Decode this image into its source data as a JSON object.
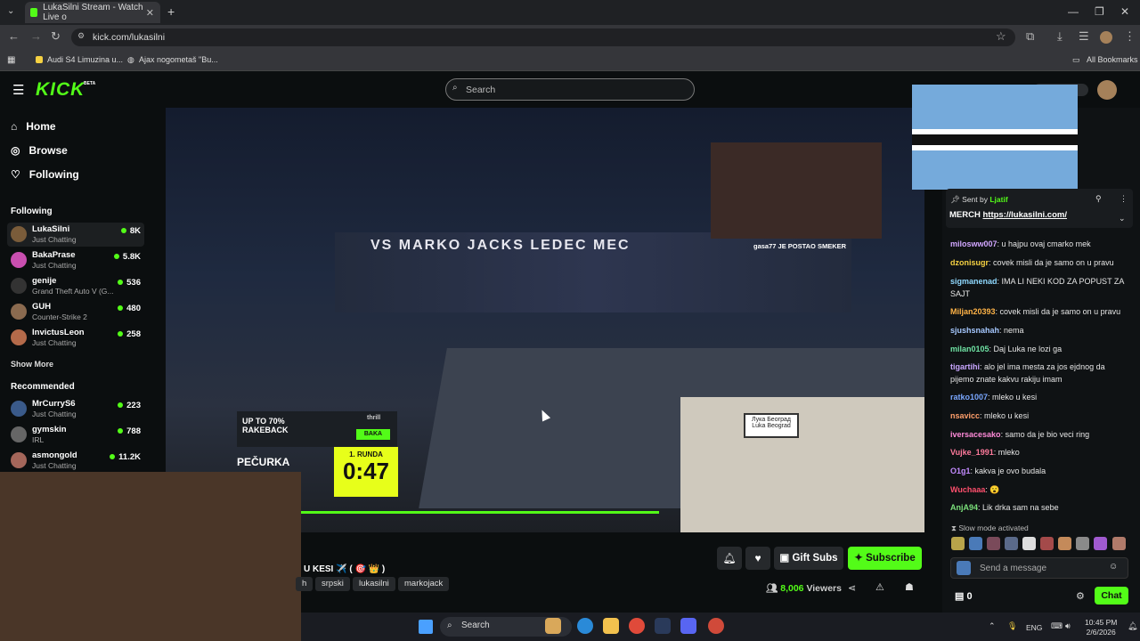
{
  "browser": {
    "tab_title": "LukaSilni Stream - Watch Live o",
    "url": "kick.com/lukasilni",
    "bookmarks": [
      "Audi S4 Limuzina u...",
      "Ajax nogometaš \"Bu..."
    ],
    "all_bookmarks": "All Bookmarks"
  },
  "header": {
    "logo": "KICK",
    "logo_badge": "BETA",
    "search_placeholder": "Search"
  },
  "sidebar": {
    "nav": [
      {
        "label": "Home",
        "icon": "home-icon"
      },
      {
        "label": "Browse",
        "icon": "compass-icon"
      },
      {
        "label": "Following",
        "icon": "heart-icon"
      }
    ],
    "following_heading": "Following",
    "following": [
      {
        "name": "LukaSilni",
        "category": "Just Chatting",
        "viewers": "8K"
      },
      {
        "name": "BakaPrase",
        "category": "Just Chatting",
        "viewers": "5.8K"
      },
      {
        "name": "genije",
        "category": "Grand Theft Auto V (G...",
        "viewers": "536"
      },
      {
        "name": "GUH",
        "category": "Counter-Strike 2",
        "viewers": "480"
      },
      {
        "name": "InvictusLeon",
        "category": "Just Chatting",
        "viewers": "258"
      }
    ],
    "show_more": "Show More",
    "recommended_heading": "Recommended",
    "recommended": [
      {
        "name": "MrCurryS6",
        "category": "Just Chatting",
        "viewers": "223"
      },
      {
        "name": "gymskin",
        "category": "IRL",
        "viewers": "788"
      },
      {
        "name": "asmongold",
        "category": "Just Chatting",
        "viewers": "11.2K"
      }
    ]
  },
  "video": {
    "banner_text": "VS MARKO JACKS LEDEC MEC",
    "pip_caption": "gasa77 JE POSTAO SMEKER",
    "ad_line1": "UP TO 70%",
    "ad_line2": "RAKEBACK",
    "ad_brand": "thrill",
    "ad_tag": "BAKA",
    "fighter_name": "PEČURKA",
    "round_label": "1. RUNDA",
    "timer": "0:47",
    "sign_line1": "Лука Београд",
    "sign_line2": "Luka Beograd"
  },
  "stream": {
    "title": "U KESI ✈️ ( 🎯 👑 )",
    "tags": [
      "h",
      "srpski",
      "lukasilni",
      "markojack"
    ],
    "gift_subs": "Gift Subs",
    "subscribe": "Subscribe",
    "viewers_count": "8,006",
    "viewers_label": "Viewers"
  },
  "chat": {
    "pinned_sent_by": "Sent by",
    "pinned_user": "Ljatif",
    "pinned_text": "MERCH",
    "pinned_link": "https://lukasilni.com/",
    "messages": [
      {
        "user": "milosww007",
        "color": "#d1a6ff",
        "text": "u hajpu ovaj cmarko mek"
      },
      {
        "user": "dzonisugr",
        "color": "#f5d142",
        "text": "covek misli da je samo on u pravu"
      },
      {
        "user": "sigmanenad",
        "color": "#8fd9ff",
        "text": "IMA LI NEKI KOD ZA POPUST ZA SAJT"
      },
      {
        "user": "Miljan20393",
        "color": "#ffb347",
        "text": "covek misli da je samo on u pravu"
      },
      {
        "user": "sjushsnahah",
        "color": "#a6c8ff",
        "text": "nema"
      },
      {
        "user": "milan0105",
        "color": "#6fe3a4",
        "text": "Daj Luka ne lozi ga"
      },
      {
        "user": "tigartihi",
        "color": "#c8a6ff",
        "text": "alo jel ima mesta za jos ejdnog da pijemo znate kakvu rakiju imam"
      },
      {
        "user": "ratko1007",
        "color": "#7aa7ff",
        "text": "mleko u kesi"
      },
      {
        "user": "nsavicc",
        "color": "#ff9f6b",
        "text": "mleko u kesi"
      },
      {
        "user": "iversacesako",
        "color": "#ff8ad8",
        "text": "samo da je bio veci ring"
      },
      {
        "user": "Vujke_1991",
        "color": "#ff7a9c",
        "text": "mleko"
      },
      {
        "user": "O1g1",
        "color": "#c38bff",
        "text": "kakva je ovo budala"
      },
      {
        "user": "Wuchaaa",
        "color": "#ff4f6d",
        "text": "😮"
      },
      {
        "user": "AnjA94",
        "color": "#7be07b",
        "text": "Lik drka sam na sebe"
      }
    ],
    "slow_mode": "Slow mode activated",
    "send_placeholder": "Send a message",
    "points": "0",
    "chat_button": "Chat"
  },
  "taskbar": {
    "search": "Search",
    "lang": "ENG",
    "time": "10:45 PM",
    "date": "2/6/2026"
  },
  "colors": {
    "accent": "#53fc18",
    "background": "#0b0e0f"
  }
}
